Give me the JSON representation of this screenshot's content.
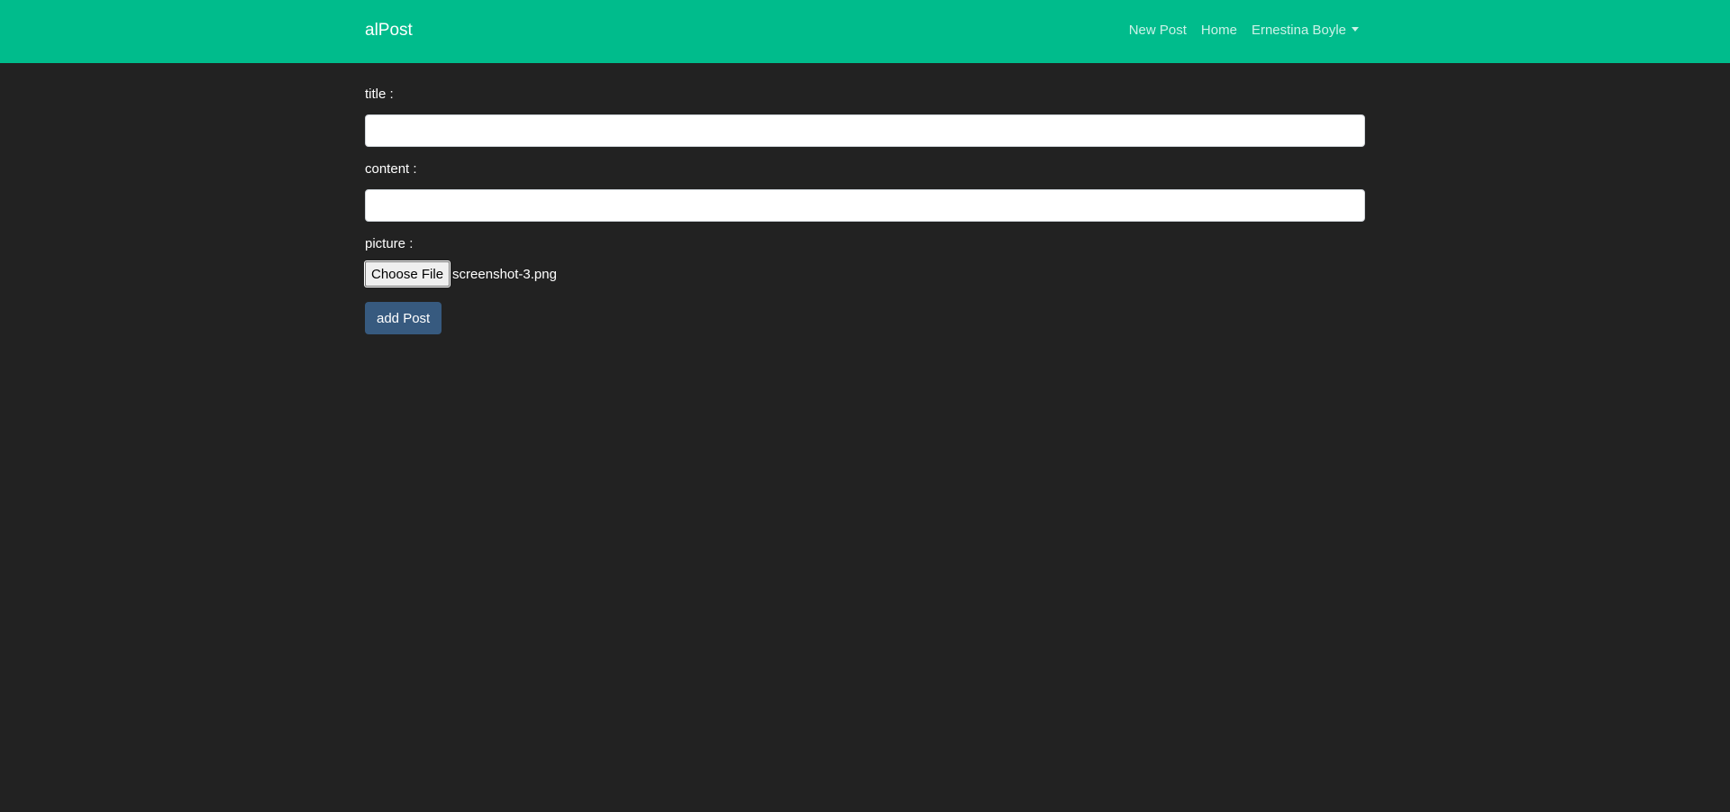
{
  "navbar": {
    "brand": "alPost",
    "links": {
      "new_post": "New Post",
      "home": "Home",
      "user": "Ernestina Boyle"
    },
    "user_dropdown_icon": "caret-down-icon",
    "background_color": "#00bc8c"
  },
  "form": {
    "title_label": "title :",
    "title_value": "",
    "content_label": "content :",
    "content_value": "",
    "picture_label": "picture :",
    "file_button_label": "Choose File",
    "file_name": "screenshot-3.png",
    "submit_label": "add Post",
    "submit_color": "#375a7f"
  },
  "page": {
    "background_color": "#222222"
  }
}
